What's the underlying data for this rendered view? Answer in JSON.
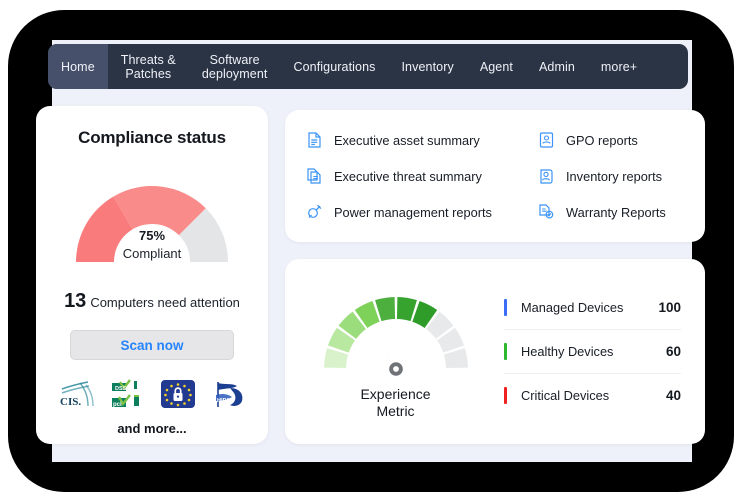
{
  "navbar": {
    "tabs": [
      {
        "label": "Home",
        "active": true
      },
      {
        "label": "Threats &\nPatches",
        "active": false
      },
      {
        "label": "Software\ndeployment",
        "active": false
      },
      {
        "label": "Configurations",
        "active": false
      },
      {
        "label": "Inventory",
        "active": false
      },
      {
        "label": "Agent",
        "active": false
      },
      {
        "label": "Admin",
        "active": false
      },
      {
        "label": "more+",
        "active": false
      }
    ],
    "background": "#2b3444",
    "active_background": "#46506a"
  },
  "compliance": {
    "title": "Compliance status",
    "percent_label": "75%",
    "percent_value": 75,
    "state_label": "Compliant",
    "attention_count": "13",
    "attention_text": "Computers need attention",
    "scan_button": "Scan now",
    "scan_button_color": "#2684fc",
    "and_more": "and more...",
    "arc_color_primary": "#f97b7b",
    "arc_color_secondary": "#fa8b8b",
    "arc_color_empty": "#e4e5e7",
    "logos": [
      {
        "name": "cis-logo",
        "alt": "CIS"
      },
      {
        "name": "pci-dss-logo",
        "alt": "PCI DSS"
      },
      {
        "name": "gdpr-logo",
        "alt": "GDPR"
      },
      {
        "name": "hipaa-logo",
        "alt": "HIPAA"
      }
    ]
  },
  "reports": {
    "items": [
      {
        "label": "Executive asset summary",
        "icon": "document-report-icon",
        "column": "left"
      },
      {
        "label": "GPO reports",
        "icon": "gpo-document-icon",
        "column": "right"
      },
      {
        "label": "Executive threat summary",
        "icon": "documents-copy-icon",
        "column": "left"
      },
      {
        "label": "Inventory reports",
        "icon": "inventory-person-icon",
        "column": "right"
      },
      {
        "label": "Power management reports",
        "icon": "power-plug-icon",
        "column": "left"
      },
      {
        "label": "Warranty Reports",
        "icon": "warranty-document-icon",
        "column": "right"
      }
    ],
    "icon_color": "#3b94f6"
  },
  "experience": {
    "metric_label": "Experience\nMetric",
    "needle_angle_deg": -28,
    "gauge_segments": [
      {
        "color": "#d9f2cc",
        "active": true
      },
      {
        "color": "#b9e8a1",
        "active": true
      },
      {
        "color": "#9bdd7d",
        "active": true
      },
      {
        "color": "#7ed159",
        "active": true
      },
      {
        "color": "#4caf3e",
        "active": true
      },
      {
        "color": "#37a32f",
        "active": true
      },
      {
        "color": "#2f9c2a",
        "active": true
      },
      {
        "color": "#e8e9ea",
        "active": false
      },
      {
        "color": "#e8e9ea",
        "active": false
      },
      {
        "color": "#e8e9ea",
        "active": false
      }
    ],
    "devices": [
      {
        "label": "Managed Devices",
        "value": "100",
        "color": "#3b6df6"
      },
      {
        "label": "Healthy Devices",
        "value": "60",
        "color": "#2fb82f"
      },
      {
        "label": "Critical Devices",
        "value": "40",
        "color": "#ef2222"
      }
    ]
  },
  "theme": {
    "page_background": "#eef1f9",
    "card_background": "#ffffff",
    "frame_color": "#000000"
  }
}
